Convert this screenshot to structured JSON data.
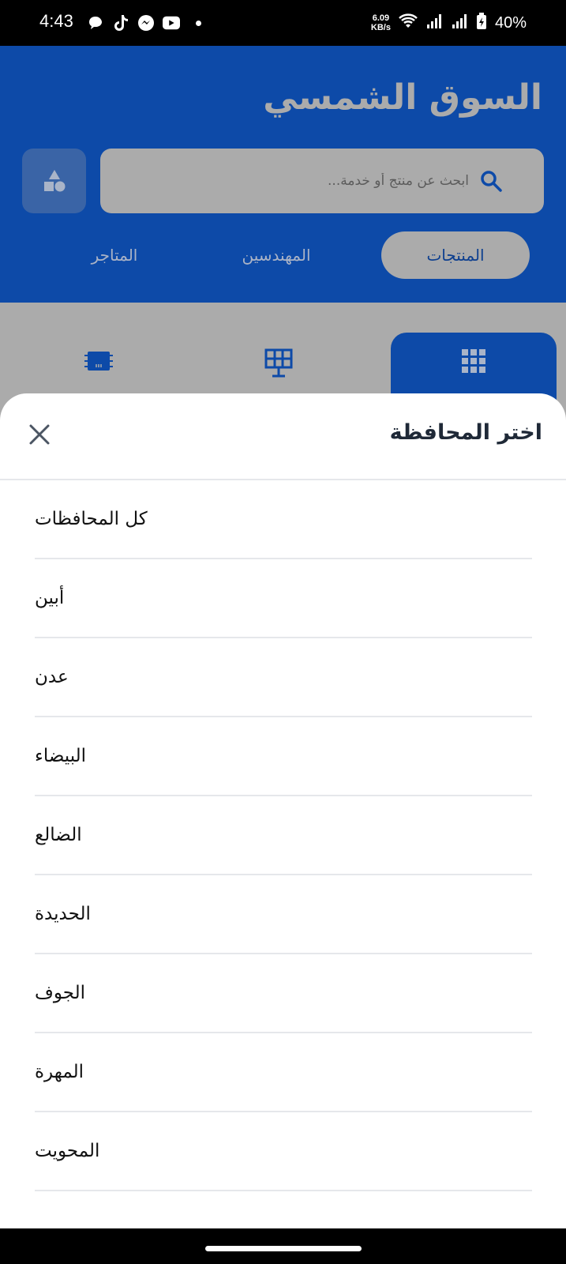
{
  "status_bar": {
    "time": "4:43",
    "speed_value": "6.09",
    "speed_unit": "KB/s",
    "battery": "40%",
    "icons": [
      "chat-bubble-icon",
      "tiktok-icon",
      "messenger-icon",
      "youtube-icon",
      "wifi-icon",
      "signal-icon",
      "signal-icon",
      "battery-charging-icon"
    ]
  },
  "header": {
    "title": "السوق الشمسي",
    "search_placeholder": "ابحث عن منتج أو خدمة...",
    "tabs": [
      {
        "label": "المنتجات",
        "active": true
      },
      {
        "label": "المهندسين",
        "active": false
      },
      {
        "label": "المتاجر",
        "active": false
      }
    ]
  },
  "category_strip": {
    "icons": [
      "grid-icon",
      "solar-panel-icon",
      "battery-chip-icon"
    ]
  },
  "sheet": {
    "title": "اختر المحافظة",
    "items": [
      "كل المحافظات",
      "أبين",
      "عدن",
      "البيضاء",
      "الضالع",
      "الحديدة",
      "الجوف",
      "المهرة",
      "المحويت"
    ]
  },
  "colors": {
    "brand_blue": "#0d4aa8",
    "overlay_grey": "#ababab",
    "divider": "#e5e7eb",
    "title_text": "#1f2937"
  }
}
